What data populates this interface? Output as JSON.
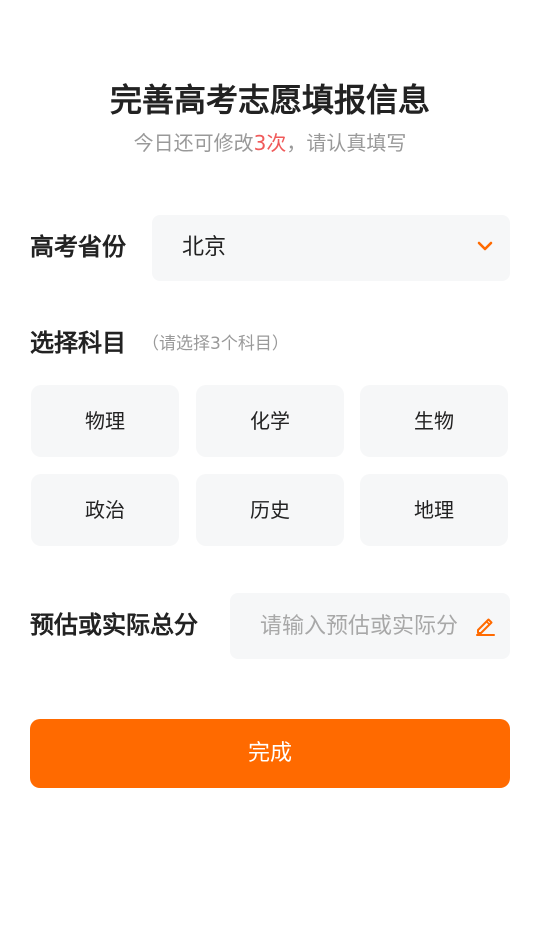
{
  "header": {
    "title": "完善高考志愿填报信息",
    "subtitle_prefix": "今日还可修改",
    "subtitle_count": "3次",
    "subtitle_suffix": "，请认真填写"
  },
  "province": {
    "label": "高考省份",
    "selected": "北京",
    "icon": "chevron-down-icon"
  },
  "subjects": {
    "title": "选择科目",
    "hint": "（请选择3个科目）",
    "items": [
      {
        "label": "物理"
      },
      {
        "label": "化学"
      },
      {
        "label": "生物"
      },
      {
        "label": "政治"
      },
      {
        "label": "历史"
      },
      {
        "label": "地理"
      }
    ]
  },
  "score": {
    "label": "预估或实际总分",
    "placeholder": "请输入预估或实际分",
    "icon": "edit-icon"
  },
  "submit": {
    "label": "完成"
  },
  "colors": {
    "accent": "#ff6a00",
    "highlight": "#f05a5a",
    "field_bg": "#f6f7f8"
  }
}
